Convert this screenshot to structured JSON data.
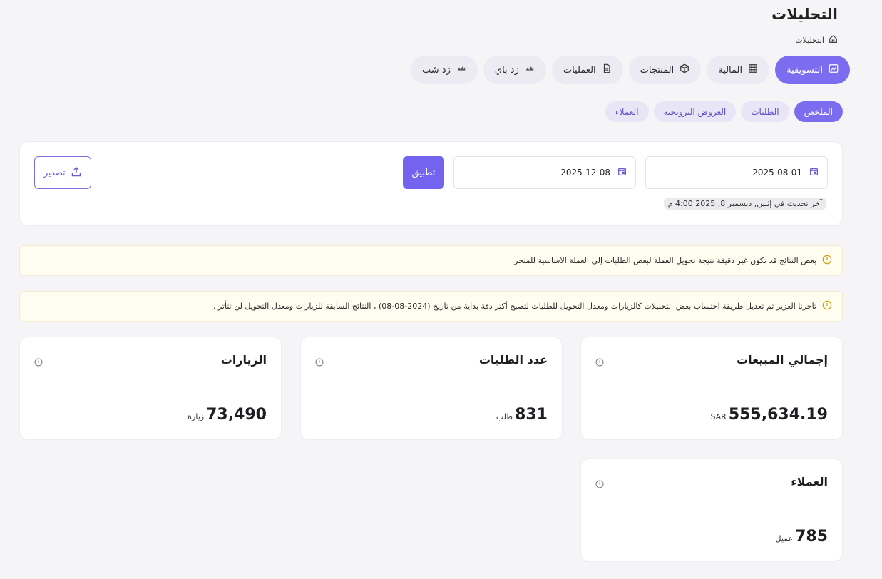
{
  "header": {
    "title": "التحليلات",
    "breadcrumb": "التحليلات"
  },
  "main_tabs": [
    {
      "label": "التسويقية",
      "icon": "chart-line-icon",
      "active": true
    },
    {
      "label": "المالية",
      "icon": "table-icon",
      "active": false
    },
    {
      "label": "المنتجات",
      "icon": "box-icon",
      "active": false
    },
    {
      "label": "العمليات",
      "icon": "document-icon",
      "active": false
    },
    {
      "label": "زد باي",
      "icon": "zid-icon",
      "active": false
    },
    {
      "label": "زد شب",
      "icon": "zid-icon",
      "active": false
    }
  ],
  "sub_tabs": [
    {
      "label": "الملخص",
      "active": true
    },
    {
      "label": "الطلبات",
      "active": false
    },
    {
      "label": "العروض الترويجية",
      "active": false
    },
    {
      "label": "العملاء",
      "active": false
    }
  ],
  "filter": {
    "start_date": "2025-08-01",
    "end_date": "2025-12-08",
    "apply_label": "تطبيق",
    "export_label": "تصدير",
    "last_update": "آخر تحديث في إثنين, ديسمبر 8, 2025 4:00 م"
  },
  "notices": [
    "بعض النتائج قد تكون غير دقيقة نتيجة تحويل العملة لبعض الطلبات إلى العملة الاساسية للمتجر",
    "تاجرنا العزيز تم تعديل طريقة احتساب بعض التحليلات كالزيارات ومعدل التحويل للطلبات لتصبح أكثر دقة بداية من تاريخ (2024-08-08) ، النتائج السابقة للزيارات ومعدل التحويل لن تتأثر ."
  ],
  "stats": {
    "sales": {
      "title": "إجمالي المبيعات",
      "value": "555,634.19",
      "unit": "SAR"
    },
    "orders": {
      "title": "عدد الطلبات",
      "value": "831",
      "unit": "طلب"
    },
    "visits": {
      "title": "الزيارات",
      "value": "73,490",
      "unit": "زيارة"
    },
    "customers": {
      "title": "العملاء",
      "value": "785",
      "unit": "عميل"
    }
  },
  "colors": {
    "accent": "#7363ee",
    "notice_bg": "#fffcf0",
    "page_bg": "#f5f5f7"
  }
}
